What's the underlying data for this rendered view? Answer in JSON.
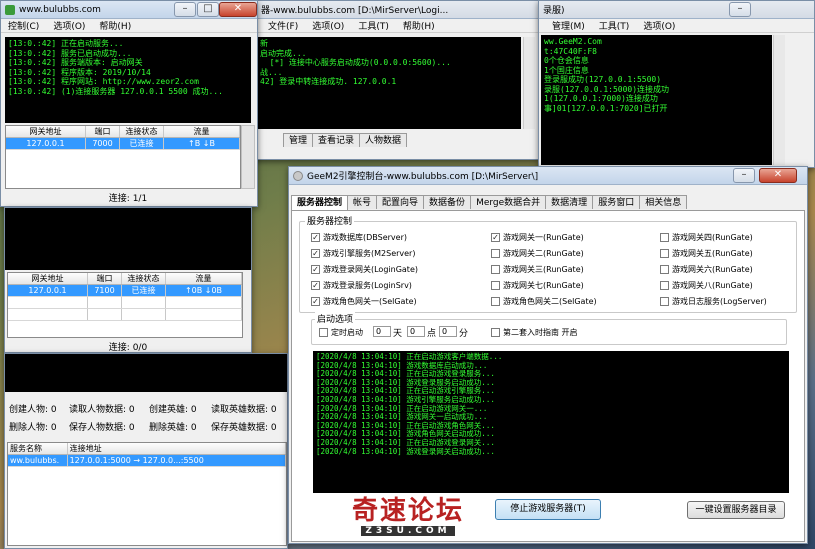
{
  "desk": {
    "colors": {
      "accent": "#3399ff",
      "console_bg": "#000000",
      "console_text": "#33ff33"
    }
  },
  "w_back": {
    "title": "器-www.bulubbs.com  [D:\\MirServer\\Logi...",
    "menu": [
      "文件(F)",
      "选项(O)",
      "工具(T)",
      "帮助(H)"
    ],
    "console": "新\n启动完成...\n  [*] 连接中心服务启动成功(0.0.0.0:5600)...\n战...\n42] 登录中转连接成功. 127.0.0.1",
    "tabs": [
      "管理",
      "查看记录",
      "人物数据"
    ]
  },
  "w_right": {
    "title": "录服)",
    "menu": [
      "管理(M)",
      "工具(T)",
      "选项(O)"
    ],
    "console": "ww.GeeM2.Com\nt:47C40F:F8\n0个仓会信息\n1个国庄信息\n登录服成功(127.0.0.1:5500)\n录服(127.0.0.1:5000)连接成功\n1(127.0.0.1:7000)连接成功\n事]01[127.0.0.1:7020]已打开"
  },
  "w_login": {
    "title": "www.bulubbs.com",
    "menu": [
      "控制(C)",
      "选项(O)",
      "帮助(H)"
    ],
    "console": "[13:0.:42] 正在启动服务...\n[13:0.:42] 服务已启动成功...\n[13:0.:42] 服务端版本: 启动网关\n[13:0.:42] 程序版本: 2019/10/14\n[13:0.:42] 程序网站: http://www.zeor2.com\n[13:0.:42] (1)连接服务器 127.0.0.1 5500 成功...",
    "grid_headers": [
      "网关地址",
      "端口",
      "连接状态",
      "流量"
    ],
    "grid_rows": [
      [
        "127.0.0.1",
        "7000",
        "已连接",
        "↑B  ↓B"
      ]
    ],
    "status": "连接: 1/1"
  },
  "w_sel": {
    "grid_headers": [
      "网关地址",
      "端口",
      "连接状态",
      "流量"
    ],
    "grid_rows": [
      [
        "127.0.0.1",
        "7100",
        "已连接",
        "↑0B  ↓0B"
      ]
    ],
    "status": "连接: 0/0"
  },
  "w_db": {
    "stats": [
      [
        "创建人物: 0",
        "读取人物数据: 0",
        "创建英雄: 0",
        "读取英雄数据: 0"
      ],
      [
        "删除人物: 0",
        "保存人物数据: 0",
        "删除英雄: 0",
        "保存英雄数据: 0"
      ]
    ],
    "grid_headers": [
      "服务名称",
      "连接地址"
    ],
    "grid_rows": [
      [
        "ww.bulubbs.",
        "127.0.0.1:5000  →  127.0.0...:5500"
      ]
    ]
  },
  "w_main": {
    "title": "GeeM2引擎控制台-www.bulubbs.com  [D:\\MirServer\\]",
    "tabs": [
      "服务器控制",
      "帐号",
      "配置向导",
      "数据备份",
      "Merge数据合并",
      "数据清理",
      "服务窗口",
      "相关信息"
    ],
    "group_title": "服务器控制",
    "checks": [
      {
        "label": "游戏数据库(DBServer)",
        "checked": true
      },
      {
        "label": "游戏网关一(RunGate)",
        "checked": true
      },
      {
        "label": "游戏网关四(RunGate)",
        "checked": false
      },
      {
        "label": "游戏引擎服务(M2Server)",
        "checked": true
      },
      {
        "label": "游戏网关二(RunGate)",
        "checked": false
      },
      {
        "label": "游戏网关五(RunGate)",
        "checked": false
      },
      {
        "label": "游戏登录网关(LoginGate)",
        "checked": true
      },
      {
        "label": "游戏网关三(RunGate)",
        "checked": false
      },
      {
        "label": "游戏网关六(RunGate)",
        "checked": false
      },
      {
        "label": "游戏登录服务(LoginSrv)",
        "checked": true
      },
      {
        "label": "游戏网关七(RunGate)",
        "checked": false
      },
      {
        "label": "游戏网关八(RunGate)",
        "checked": false
      },
      {
        "label": "游戏角色网关一(SelGate)",
        "checked": true
      },
      {
        "label": "游戏角色网关二(SelGate)",
        "checked": false
      },
      {
        "label": "游戏日志服务(LogServer)",
        "checked": false
      }
    ],
    "startup_title": "启动选项",
    "timed_start": "定时启动",
    "day": "0",
    "day_unit": "天",
    "hour": "0",
    "hour_unit": "点",
    "minute": "0",
    "minute_unit": "分",
    "second_mode": "第二套入时指南   开启",
    "console": "[2020/4/8 13:04:10] 正在启动游戏客户端数据...\n[2020/4/8 13:04:10] 游戏数据库启动成功...\n[2020/4/8 13:04:10] 正在启动游戏登录服务...\n[2020/4/8 13:04:10] 游戏登录服务启动成功...\n[2020/4/8 13:04:10] 正在启动游戏引擎服务...\n[2020/4/8 13:04:10] 游戏引擎服务启动成功...\n[2020/4/8 13:04:10] 正在启动游戏网关一...\n[2020/4/8 13:04:10] 游戏网关一启动成功...\n[2020/4/8 13:04:10] 正在启动游戏角色网关...\n[2020/4/8 13:04:10] 游戏角色网关启动成功...\n[2020/4/8 13:04:10] 正在启动游戏登录网关...\n[2020/4/8 13:04:10] 游戏登录网关启动成功...",
    "stop_button": "停止游戏服务器(T)",
    "auto_button": "一键设置服务器目录",
    "watermark": "奇速论坛",
    "watermark_sub": "Z3SU.COM"
  }
}
